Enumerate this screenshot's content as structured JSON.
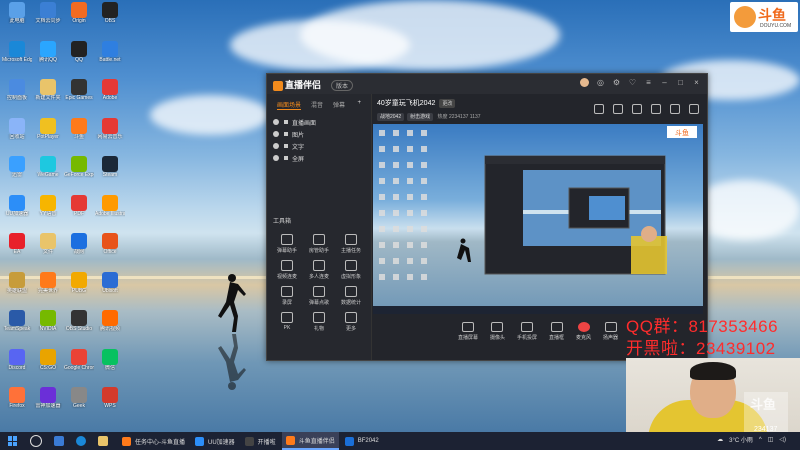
{
  "desktop": {
    "icons": [
      {
        "label": "此电脑",
        "color": "#5aa0e8"
      },
      {
        "label": "文档云同步",
        "color": "#3b7fd4"
      },
      {
        "label": "Origin",
        "color": "#f26b21"
      },
      {
        "label": "OBS",
        "color": "#222222"
      },
      {
        "label": "Microsoft Edge",
        "color": "#1a88d8"
      },
      {
        "label": "腾讯QQ",
        "color": "#2aa6ff"
      },
      {
        "label": "QQ",
        "color": "#222222"
      },
      {
        "label": "Battle.net",
        "color": "#2f7fe0"
      },
      {
        "label": "控制面板",
        "color": "#4b8be0"
      },
      {
        "label": "新建文件夹",
        "color": "#e9c46a"
      },
      {
        "label": "Epic Games",
        "color": "#333333"
      },
      {
        "label": "Adobe",
        "color": "#e53935"
      },
      {
        "label": "回收站",
        "color": "#8ab4f8"
      },
      {
        "label": "PotPlayer",
        "color": "#f0c020"
      },
      {
        "label": "斗鱼",
        "color": "#ff7a1a"
      },
      {
        "label": "网易云音乐",
        "color": "#e53935"
      },
      {
        "label": "迅雷",
        "color": "#3aa0ff"
      },
      {
        "label": "WeGame",
        "color": "#1ec8e0"
      },
      {
        "label": "GeForce Experience",
        "color": "#76b900"
      },
      {
        "label": "Steam",
        "color": "#1b2838"
      },
      {
        "label": "UU加速器",
        "color": "#2c8ef8"
      },
      {
        "label": "YY语音",
        "color": "#f7b500"
      },
      {
        "label": "PDF",
        "color": "#e53935"
      },
      {
        "label": "Adobe Illustrator",
        "color": "#ff9a00"
      },
      {
        "label": "EA",
        "color": "#e8202a"
      },
      {
        "label": "文件",
        "color": "#e9c46a"
      },
      {
        "label": "战网",
        "color": "#1b6fe0"
      },
      {
        "label": "Office",
        "color": "#e8531a"
      },
      {
        "label": "英雄联盟",
        "color": "#c79c3a"
      },
      {
        "label": "完美世界",
        "color": "#ff7a1a"
      },
      {
        "label": "PUBG",
        "color": "#f2a900"
      },
      {
        "label": "Ubisoft",
        "color": "#2b6cd4"
      },
      {
        "label": "TeamSpeak",
        "color": "#2a5aa8"
      },
      {
        "label": "NVIDIA",
        "color": "#76b900"
      },
      {
        "label": "OBS Studio",
        "color": "#333333"
      },
      {
        "label": "腾讯视频",
        "color": "#ff6a00"
      },
      {
        "label": "Discord",
        "color": "#5865f2"
      },
      {
        "label": "CS:GO",
        "color": "#e9a400"
      },
      {
        "label": "Google Chrome",
        "color": "#ea4335"
      },
      {
        "label": "微信",
        "color": "#07c160"
      },
      {
        "label": "Firefox",
        "color": "#ff7139"
      },
      {
        "label": "雷神加速器",
        "color": "#6b2fd8"
      },
      {
        "label": "Geek",
        "color": "#888888"
      },
      {
        "label": "WPS",
        "color": "#d33a2c"
      }
    ]
  },
  "douyu_logo": {
    "text": "斗鱼",
    "sub": "DOUYU.COM"
  },
  "app": {
    "title": "直播伴侣",
    "version": "版本",
    "left_tabs": [
      "画面场景",
      "混音",
      "弹幕"
    ],
    "layers": [
      "直播画面",
      "图片",
      "文字",
      "全屏"
    ],
    "tools_header": "工具箱",
    "tools": [
      "弹幕助手",
      "房管助手",
      "主播任务",
      "视频连麦",
      "多人连麦",
      "虚拟形象",
      "录屏",
      "弹幕点歌",
      "数据统计",
      "PK",
      "礼物",
      "更多"
    ],
    "stream_title": "40岁童玩飞机2042",
    "stream_badge": "更改",
    "meta": [
      "战地2042",
      "射击游戏",
      "热度",
      "2234137",
      "1137"
    ],
    "bottom": [
      "直播屏幕",
      "摄像头",
      "手机投屏",
      "直播框",
      "麦克风",
      "扬声器"
    ]
  },
  "overlay": {
    "qq_group": "QQ群：817353466",
    "kaihei": "开黑啦：23439102"
  },
  "webcam": {
    "watermark": "斗鱼",
    "room_no": "234137"
  },
  "taskbar": {
    "tasks": [
      {
        "label": "任务中心-斗鱼直播",
        "color": "#ff7a1a",
        "active": false
      },
      {
        "label": "UU加速器",
        "color": "#2c8ef8",
        "active": false
      },
      {
        "label": "开播啦",
        "color": "#444444",
        "active": false
      },
      {
        "label": "斗鱼直播伴侣",
        "color": "#ff7a1a",
        "active": true
      },
      {
        "label": "BF2042",
        "color": "#1a6fd8",
        "active": false
      }
    ],
    "weather": "3°C 小雨",
    "time": "",
    "date": ""
  }
}
